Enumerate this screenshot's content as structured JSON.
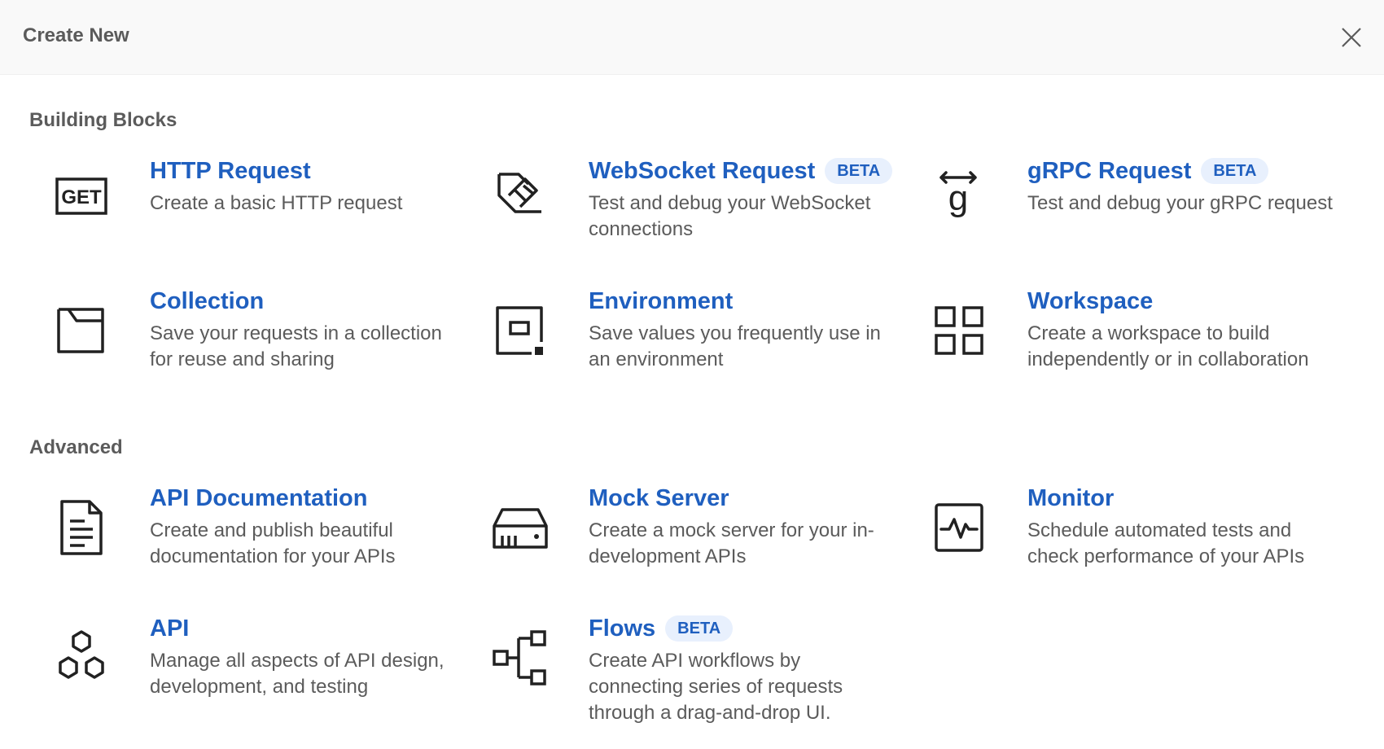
{
  "header": {
    "title": "Create New",
    "close_icon": "close-icon"
  },
  "sections": {
    "building_blocks": "Building Blocks",
    "advanced": "Advanced"
  },
  "items": {
    "http": {
      "title": "HTTP Request",
      "desc": "Create a basic HTTP request",
      "icon": "get-icon"
    },
    "websocket": {
      "title": "WebSocket Request",
      "badge": "BETA",
      "desc": "Test and debug your WebSocket connections",
      "icon": "websocket-icon"
    },
    "grpc": {
      "title": "gRPC Request",
      "badge": "BETA",
      "desc": "Test and debug your gRPC request",
      "icon": "grpc-icon"
    },
    "collection": {
      "title": "Collection",
      "desc": "Save your requests in a collection for reuse and sharing",
      "icon": "collection-icon"
    },
    "environment": {
      "title": "Environment",
      "desc": "Save values you frequently use in an environment",
      "icon": "environment-icon"
    },
    "workspace": {
      "title": "Workspace",
      "desc": "Create a workspace to build independently or in collaboration",
      "icon": "workspace-icon"
    },
    "api_docs": {
      "title": "API Documentation",
      "desc": "Create and publish beautiful documentation for your APIs",
      "icon": "document-icon"
    },
    "mock_server": {
      "title": "Mock Server",
      "desc": "Create a mock server for your in-development APIs",
      "icon": "server-icon"
    },
    "monitor": {
      "title": "Monitor",
      "desc": "Schedule automated tests and check performance of your APIs",
      "icon": "monitor-icon"
    },
    "api": {
      "title": "API",
      "desc": "Manage all aspects of API design, development, and testing",
      "icon": "api-hexagons-icon"
    },
    "flows": {
      "title": "Flows",
      "badge": "BETA",
      "desc": "Create API workflows by connecting series of requests through a drag-and-drop UI.",
      "icon": "flows-icon"
    }
  }
}
